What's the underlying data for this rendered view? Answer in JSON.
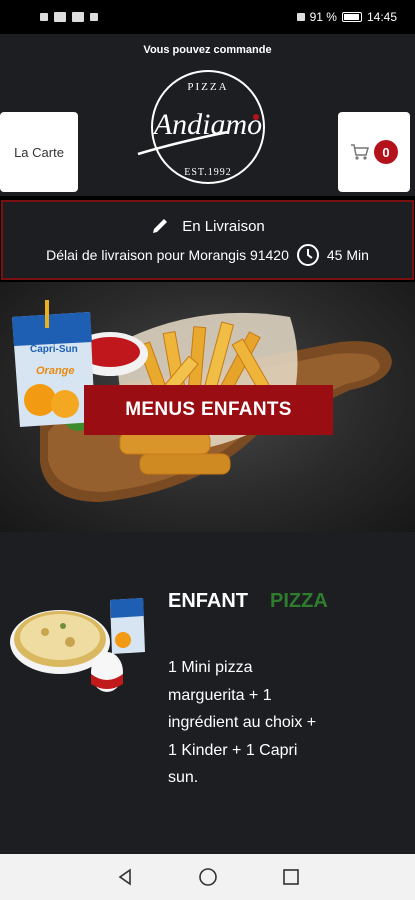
{
  "status_bar": {
    "battery": "91 %",
    "time": "14:45"
  },
  "header": {
    "scroll_message": "Vous pouvez commande",
    "logo": {
      "top_text": "PIZZA",
      "script_text": "Andiamo",
      "bottom_text": "EST.1992"
    },
    "menu_button_label": "La Carte",
    "cart_count": "0"
  },
  "delivery": {
    "mode_label": "En Livraison",
    "delay_label": "Délai de livraison pour Morangis 91420",
    "delay_time": "45 Min"
  },
  "banner": {
    "category_label": "MENUS ENFANTS",
    "juice_brand": "Capri-Sun",
    "juice_flavor": "Orange"
  },
  "product": {
    "name": "ENFANT",
    "category": "PIZZA",
    "description": "1 Mini pizza marguerita + 1 ingrédient au choix + 1 Kinder + 1 Capri sun."
  },
  "colors": {
    "accent_red": "#9a0d12",
    "border_red": "#7a1010",
    "category_green": "#2f7d2c",
    "panel_bg": "#1c1e22"
  },
  "icons": [
    "pencil-icon",
    "clock-icon",
    "cart-icon",
    "back-nav-icon",
    "home-nav-icon",
    "recents-nav-icon"
  ]
}
